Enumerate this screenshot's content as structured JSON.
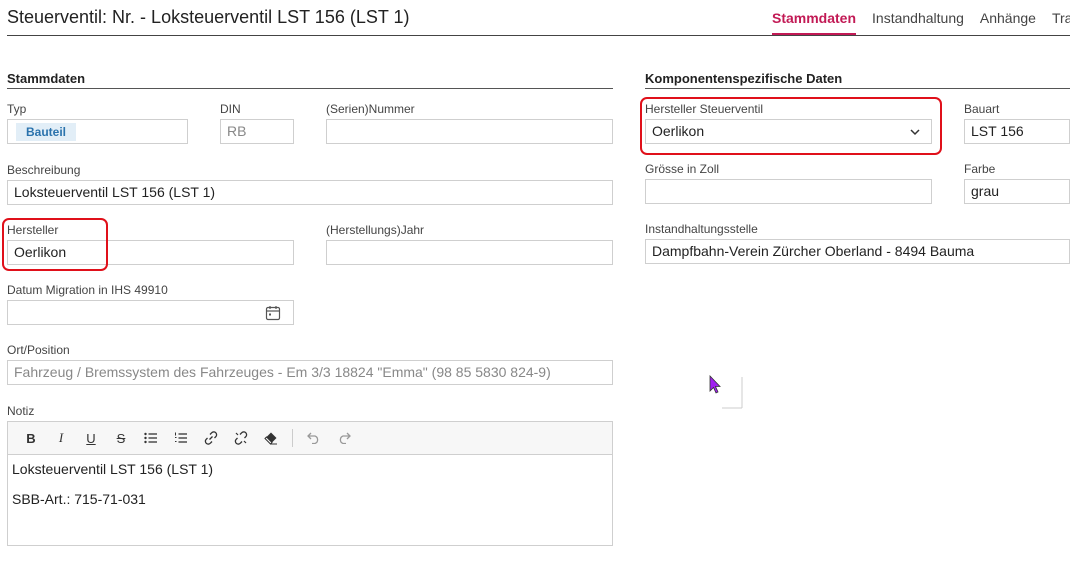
{
  "header": {
    "title": "Steuerventil: Nr. - Loksteuerventil LST 156 (LST 1)",
    "tabs": [
      "Stammdaten",
      "Instandhaltung",
      "Anhänge",
      "Tra"
    ],
    "active_tab": "Stammdaten"
  },
  "stammdaten": {
    "section_title": "Stammdaten",
    "typ": {
      "label": "Typ",
      "value": "Bauteil"
    },
    "din": {
      "label": "DIN",
      "value": "RB"
    },
    "nummer": {
      "label": "(Serien)Nummer",
      "value": ""
    },
    "beschreibung": {
      "label": "Beschreibung",
      "value": "Loksteuerventil LST 156 (LST 1)"
    },
    "hersteller": {
      "label": "Hersteller",
      "value": "Oerlikon"
    },
    "jahr": {
      "label": "(Herstellungs)Jahr",
      "value": ""
    },
    "datum_migration": {
      "label": "Datum Migration in IHS 49910",
      "value": ""
    },
    "ort_position": {
      "label": "Ort/Position",
      "value": "Fahrzeug / Bremssystem des Fahrzeuges - Em 3/3 18824 \"Emma\" (98 85 5830 824-9)"
    },
    "notiz": {
      "label": "Notiz",
      "lines": [
        "Loksteuerventil LST 156 (LST 1)",
        "SBB-Art.: 715-71-031"
      ]
    }
  },
  "komponenten": {
    "section_title": "Komponentenspezifische Daten",
    "hersteller_steuerventil": {
      "label": "Hersteller Steuerventil",
      "value": "Oerlikon"
    },
    "bauart": {
      "label": "Bauart",
      "value": "LST 156"
    },
    "groesse": {
      "label": "Grösse in Zoll",
      "value": ""
    },
    "farbe": {
      "label": "Farbe",
      "value": "grau"
    },
    "instandhaltungsstelle": {
      "label": "Instandhaltungsstelle",
      "value": "Dampfbahn-Verein Zürcher Oberland - 8494 Bauma"
    }
  },
  "colors": {
    "accent": "#c21a55",
    "highlight": "#e0101a",
    "badge_bg": "#e2eef7",
    "badge_text": "#2b73ad"
  }
}
